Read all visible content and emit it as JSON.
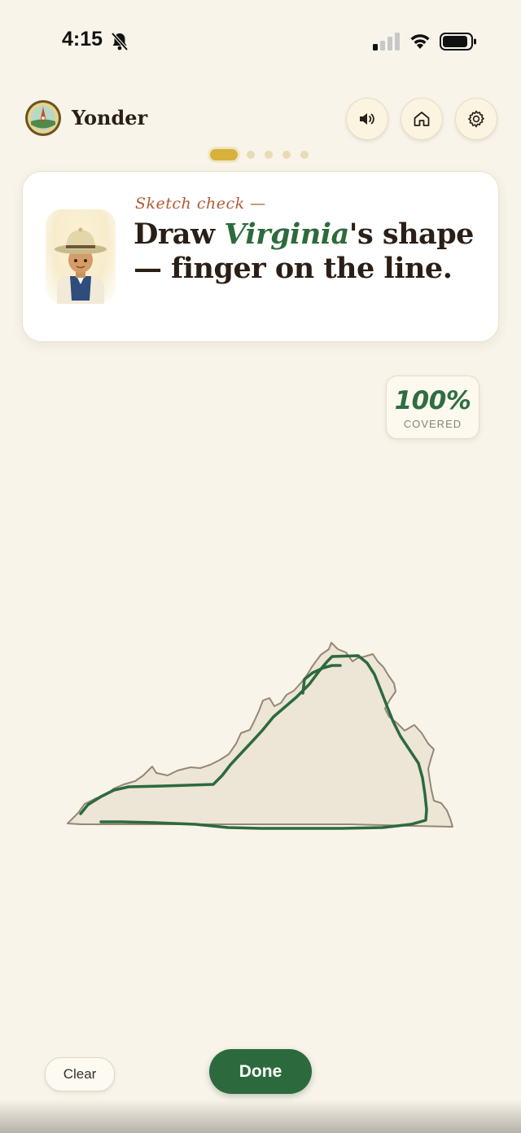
{
  "status_bar": {
    "time": "4:15",
    "icons": [
      "bell-slash-icon",
      "signal-icon",
      "wifi-icon",
      "battery-icon"
    ]
  },
  "header": {
    "app_name": "Yonder",
    "logo_icon": "compass-badge-icon",
    "buttons": [
      {
        "name": "sound-button",
        "icon": "speaker-icon"
      },
      {
        "name": "home-button",
        "icon": "home-icon"
      },
      {
        "name": "settings-button",
        "icon": "gear-icon"
      }
    ]
  },
  "progress": {
    "total": 5,
    "current": 1
  },
  "prompt": {
    "kicker": "Sketch check —",
    "title_prefix": "Draw ",
    "state_name": "Virginia",
    "title_suffix": "'s shape — finger on the line."
  },
  "coverage": {
    "value": "100%",
    "label": "COVERED"
  },
  "actions": {
    "clear_label": "Clear",
    "done_label": "Done"
  },
  "colors": {
    "background": "#f8f4ea",
    "accent_green": "#2c6a3e",
    "kicker_orange": "#b25a35",
    "progress_gold": "#d8b13c",
    "state_fill": "#ede5d6",
    "state_outline": "#958775"
  }
}
